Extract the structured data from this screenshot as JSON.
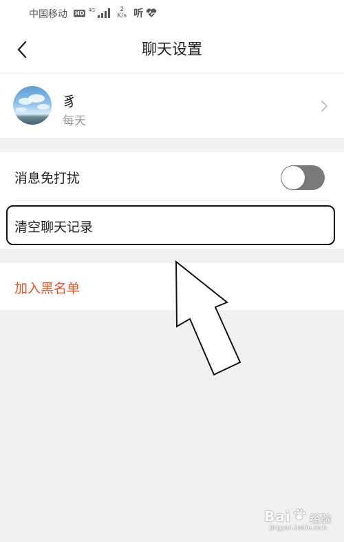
{
  "status_bar": {
    "carrier": "中国移动",
    "hd": "HD",
    "net_type": "4G",
    "speed_value": "2",
    "speed_unit": "K/s",
    "listen": "听",
    "icons": [
      "hd-icon",
      "signal-icon",
      "heart-pulse-icon"
    ]
  },
  "nav": {
    "title": "聊天设置",
    "back_icon": "chevron-left-icon"
  },
  "contact": {
    "name": "豸",
    "subtitle": "每天",
    "chevron_icon": "chevron-right-icon"
  },
  "settings": {
    "dnd_label": "消息免打扰",
    "dnd_enabled": false,
    "clear_label": "清空聊天记录",
    "blacklist_label": "加入黑名单"
  },
  "colors": {
    "danger": "#e0562a",
    "toggle_track": "#7a7a7a",
    "page_bg": "#f1f1f3"
  },
  "watermark": {
    "brand": "Bai",
    "jy": "经验",
    "url": "jingyan.baidu.com"
  }
}
